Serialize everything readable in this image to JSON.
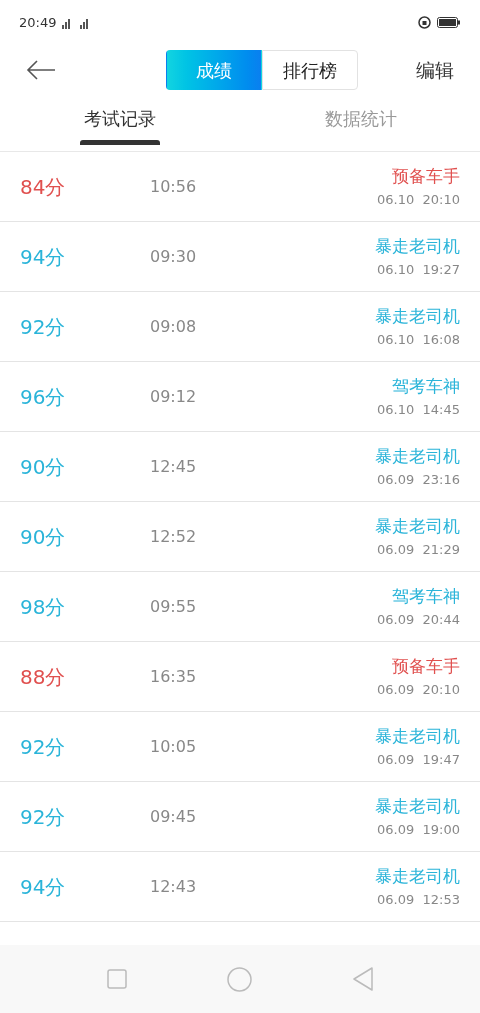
{
  "status_bar": {
    "time": "20:49"
  },
  "header": {
    "segments": [
      {
        "label": "成绩",
        "selected": true
      },
      {
        "label": "排行榜",
        "selected": false
      }
    ],
    "action": "编辑"
  },
  "tabs": [
    {
      "label": "考试记录",
      "selected": true
    },
    {
      "label": "数据统计",
      "selected": false
    }
  ],
  "records": [
    {
      "score": "84分",
      "duration": "10:56",
      "title": "预备车手",
      "datetime": "06.10  20:10",
      "color": "#e0504f"
    },
    {
      "score": "94分",
      "duration": "09:30",
      "title": "暴走老司机",
      "datetime": "06.10  19:27",
      "color": "#2ab4d9"
    },
    {
      "score": "92分",
      "duration": "09:08",
      "title": "暴走老司机",
      "datetime": "06.10  16:08",
      "color": "#2ab4d9"
    },
    {
      "score": "96分",
      "duration": "09:12",
      "title": "驾考车神",
      "datetime": "06.10  14:45",
      "color": "#2ab4d9"
    },
    {
      "score": "90分",
      "duration": "12:45",
      "title": "暴走老司机",
      "datetime": "06.09  23:16",
      "color": "#2ab4d9"
    },
    {
      "score": "90分",
      "duration": "12:52",
      "title": "暴走老司机",
      "datetime": "06.09  21:29",
      "color": "#2ab4d9"
    },
    {
      "score": "98分",
      "duration": "09:55",
      "title": "驾考车神",
      "datetime": "06.09  20:44",
      "color": "#2ab4d9"
    },
    {
      "score": "88分",
      "duration": "16:35",
      "title": "预备车手",
      "datetime": "06.09  20:10",
      "color": "#e0504f"
    },
    {
      "score": "92分",
      "duration": "10:05",
      "title": "暴走老司机",
      "datetime": "06.09  19:47",
      "color": "#2ab4d9"
    },
    {
      "score": "92分",
      "duration": "09:45",
      "title": "暴走老司机",
      "datetime": "06.09  19:00",
      "color": "#2ab4d9"
    },
    {
      "score": "94分",
      "duration": "12:43",
      "title": "暴走老司机",
      "datetime": "06.09  12:53",
      "color": "#2ab4d9"
    }
  ]
}
